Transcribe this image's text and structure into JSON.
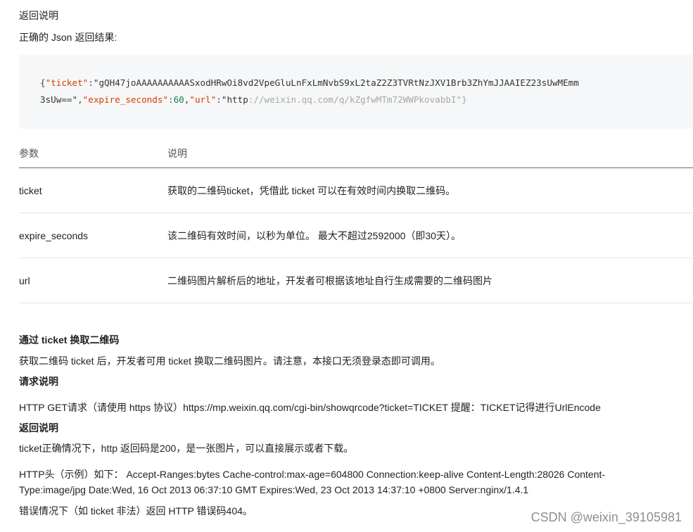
{
  "section1": {
    "heading": "返回说明",
    "intro": "正确的 Json 返回结果:"
  },
  "code": {
    "brace_open": "{",
    "key_ticket": "\"ticket\"",
    "colon1": ":",
    "val_ticket_part1": "\"gQH47joAAAAAAAAAASxodHRwOi8vd2VpeGluLnFxLmNvbS9xL2taZ2Z3TVRtNzJXV1Brb3ZhYmJJAAIEZ23sUwMEmm",
    "val_ticket_part2": "3sUw==\"",
    "comma1": ",",
    "key_expire": "\"expire_seconds\"",
    "colon2": ":",
    "val_expire": "60",
    "comma2": ",",
    "key_url": "\"url\"",
    "colon3": ":",
    "val_url_a": "\"http",
    "val_url_b": "://weixin.qq.com/q/kZgfwMTm72WWPkovabbI\"",
    "brace_close": "}"
  },
  "table": {
    "headers": [
      "参数",
      "说明"
    ],
    "rows": [
      [
        "ticket",
        "获取的二维码ticket，凭借此 ticket 可以在有效时间内换取二维码。"
      ],
      [
        "expire_seconds",
        "该二维码有效时间，以秒为单位。 最大不超过2592000（即30天）。"
      ],
      [
        "url",
        "二维码图片解析后的地址，开发者可根据该地址自行生成需要的二维码图片"
      ]
    ]
  },
  "section2": {
    "title": "通过 ticket 换取二维码",
    "desc": "获取二维码 ticket 后，开发者可用 ticket 换取二维码图片。请注意，本接口无须登录态即可调用。",
    "request_heading": "请求说明",
    "request_text": "HTTP GET请求（请使用 https 协议）https://mp.weixin.qq.com/cgi-bin/showqrcode?ticket=TICKET 提醒：TICKET记得进行UrlEncode",
    "return_heading": "返回说明",
    "return_text": "ticket正确情况下，http 返回码是200，是一张图片，可以直接展示或者下载。",
    "http_header_line1": "HTTP头（示例）如下： Accept-Ranges:bytes Cache-control:max-age=604800 Connection:keep-alive Content-Length:28026 Content-",
    "http_header_line2": "Type:image/jpg Date:Wed, 16 Oct 2013 06:37:10 GMT Expires:Wed, 23 Oct 2013 14:37:10 +0800 Server:nginx/1.4.1",
    "error_text": "错误情况下（如 ticket 非法）返回 HTTP 错误码404。"
  },
  "watermark": "CSDN @weixin_39105981",
  "colors": {
    "code_bg": "#f6f7f8",
    "json_key": "#d83b01",
    "json_number": "#0a8a3e",
    "url_faded": "#a8a8a8",
    "header_border": "#6c6c6c",
    "row_border": "#e6e6e6"
  }
}
